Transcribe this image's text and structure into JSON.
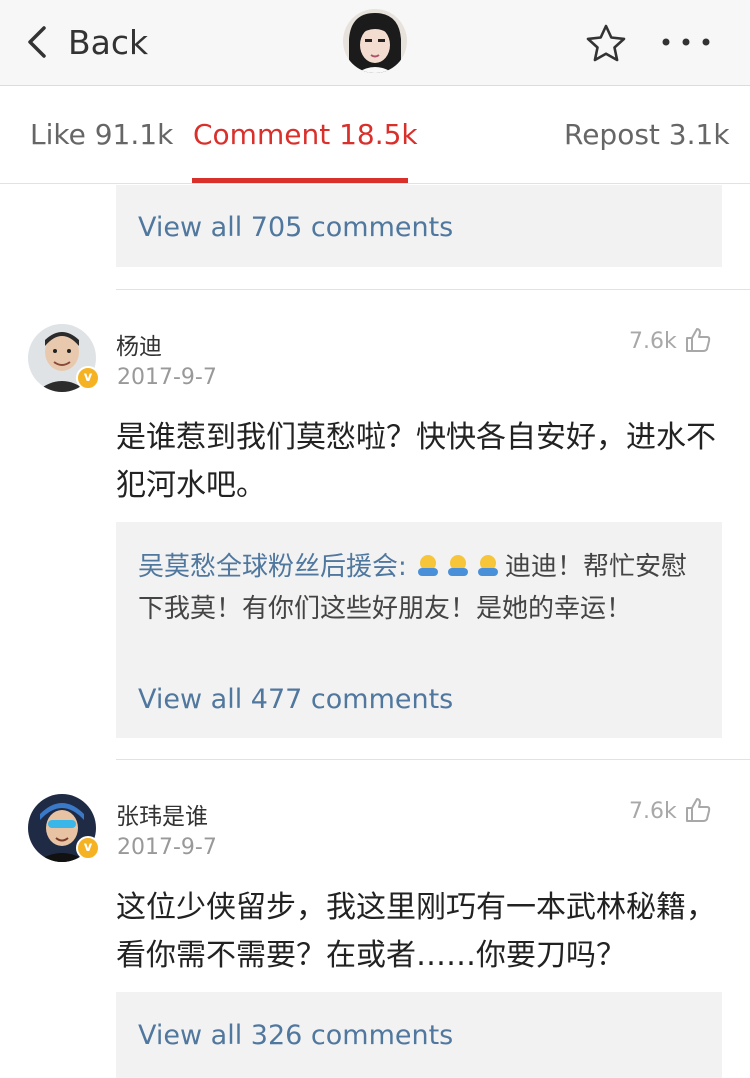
{
  "nav": {
    "back_label": "Back",
    "avatar_icon": "user-avatar",
    "star_icon": "star-outline-icon",
    "more_icon": "more-dots-icon"
  },
  "tabs": [
    {
      "label": "Like 91.1k",
      "active": false
    },
    {
      "label": "Comment 18.5k",
      "active": true
    },
    {
      "label": "Repost 3.1k",
      "active": false
    }
  ],
  "colors": {
    "accent": "#d9302c",
    "link": "#50779e",
    "badge": "#f5b324",
    "reply_bg": "#f2f2f2"
  },
  "top_reply": {
    "view_all": "View all 705 comments"
  },
  "comments": [
    {
      "username": "杨迪",
      "date": "2017-9-7",
      "likes": "7.6k",
      "badge": "v",
      "text": "是谁惹到我们莫愁啦？快快各自安好，进水不犯河水吧。",
      "reply_author": "吴莫愁全球粉丝后援会:",
      "reply_text": "迪迪！帮忙安慰下我莫！有你们这些好朋友！是她的幸运！",
      "reply_emoji": "hug-emoji",
      "view_all": "View all 477 comments"
    },
    {
      "username": "张玮是谁",
      "date": "2017-9-7",
      "likes": "7.6k",
      "badge": "v",
      "text": "这位少侠留步，我这里刚巧有一本武林秘籍，看你需不需要？在或者……你要刀吗？",
      "view_all": "View all 326 comments"
    }
  ]
}
